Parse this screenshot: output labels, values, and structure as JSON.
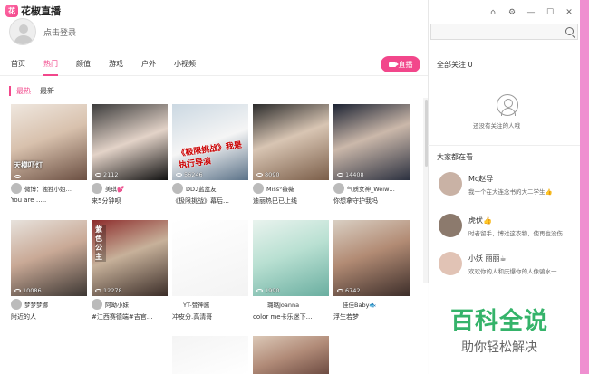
{
  "app": {
    "name": "花椒直播",
    "logo_badge": "花"
  },
  "user": {
    "login": "点击登录"
  },
  "nav": {
    "tabs": [
      "首页",
      "热门",
      "颜值",
      "游戏",
      "户外",
      "小视频"
    ],
    "active": "热门"
  },
  "live_button": "直播",
  "subtabs": {
    "items": [
      "最热",
      "最新"
    ],
    "active": "最热"
  },
  "cards": [
    {
      "count": "",
      "host": "微博：独独小姐…",
      "title": "You are …..",
      "overlay": "天模吓灯"
    },
    {
      "count": "2112",
      "host": "美琪💕",
      "title": "来5分钟呗",
      "overlay": ""
    },
    {
      "count": "56246",
      "host": "DD♪蓝盆友",
      "title": "《极限挑战》幕后…",
      "overlay": "《极限挑战》我是执行导演"
    },
    {
      "count": "8090",
      "host": "Miss°薇薇",
      "title": "迪丽热巴已上线",
      "overlay": ""
    },
    {
      "count": "14408",
      "host": "气质女神_Weiw…",
      "title": "你想拿守护我吗",
      "overlay": ""
    },
    {
      "count": "10086",
      "host": "梦梦梦娜",
      "title": "附近的人",
      "overlay": ""
    },
    {
      "count": "12278",
      "host": "阿呦小妹",
      "title": "#江西赛德端#吉官…",
      "overlay": "紫色公主"
    },
    {
      "count": "",
      "host": "YT-赞神酱",
      "title": "冲皮分.高清哥",
      "overlay": ""
    },
    {
      "count": "1990",
      "host": "璐璐Joanna",
      "title": "color me卡乐迷下…",
      "overlay": ""
    },
    {
      "count": "6742",
      "host": "佳佳Baby🐟",
      "title": "浮生若梦",
      "overlay": ""
    },
    {
      "count": "",
      "host": "",
      "title": "",
      "overlay": ""
    },
    {
      "count": "",
      "host": "",
      "title": "",
      "overlay": ""
    }
  ],
  "sidebar": {
    "follow_title": "全部关注 0",
    "empty_text": "还没有关注的人哦",
    "watch_title": "大家都在看",
    "watching": [
      {
        "name": "Mc赵导",
        "desc": "我一个在大连念书的大二学生👍"
      },
      {
        "name": "虎伏👍",
        "desc": "时者留手，博过这衣物，使再也没伤"
      },
      {
        "name": "小妖 丽丽☕",
        "desc": "欢欢你的人和庆爆你的人像骗水一…"
      }
    ]
  },
  "window_controls": [
    "⌂",
    "⚙",
    "—",
    "☐",
    "✕"
  ],
  "watermark": {
    "main": "百科全说",
    "sub": "助你轻松解决"
  }
}
